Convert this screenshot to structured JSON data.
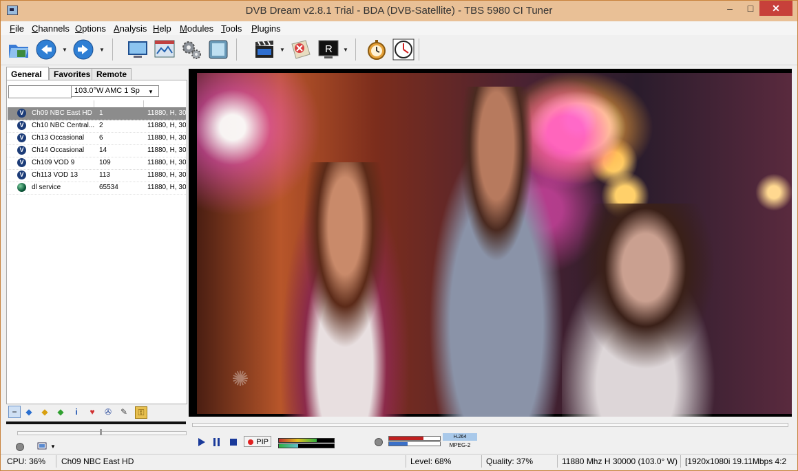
{
  "window": {
    "title": "DVB Dream v2.8.1 Trial - BDA (DVB-Satellite)  -  TBS 5980 CI Tuner",
    "buttons": {
      "minimize": "–",
      "maximize": "□",
      "close": "✕"
    }
  },
  "menu": [
    "File",
    "Channels",
    "Options",
    "Analysis",
    "Help",
    "Modules",
    "Tools",
    "Plugins"
  ],
  "toolbar": {
    "icons": [
      "open-folder-icon",
      "back-icon",
      "forward-icon",
      "monitor-icon",
      "epg-icon",
      "settings-gears-icon",
      "snapshot-icon",
      "clapperboard-icon",
      "stop-record-icon",
      "record-r-icon",
      "timer-stopwatch-icon",
      "clock-icon"
    ]
  },
  "left_panel": {
    "tabs": [
      "General",
      "Favorites",
      "Remote"
    ],
    "active_tab": "General",
    "filter": {
      "value": ""
    },
    "satellite": "103.0°W AMC 1   Sp",
    "channels": [
      {
        "name": "Ch09 NBC East HD",
        "number": "1",
        "freq": "11880, H, 30",
        "icon": "tv-channel-icon",
        "selected": true
      },
      {
        "name": "Ch10 NBC Central...",
        "number": "2",
        "freq": "11880, H, 30",
        "icon": "tv-channel-icon",
        "selected": false
      },
      {
        "name": "Ch13 Occasional",
        "number": "6",
        "freq": "11880, H, 30",
        "icon": "tv-channel-icon",
        "selected": false
      },
      {
        "name": "Ch14 Occasional",
        "number": "14",
        "freq": "11880, H, 30",
        "icon": "tv-channel-icon",
        "selected": false
      },
      {
        "name": "Ch109 VOD 9",
        "number": "109",
        "freq": "11880, H, 30",
        "icon": "tv-channel-icon",
        "selected": false
      },
      {
        "name": "Ch113 VOD 13",
        "number": "113",
        "freq": "11880, H, 30",
        "icon": "tv-channel-icon",
        "selected": false
      },
      {
        "name": "dl service",
        "number": "65534",
        "freq": "11880, H, 30",
        "icon": "data-service-globe-icon",
        "selected": false
      }
    ]
  },
  "playback": {
    "pip_label": "PIP",
    "codec_video": "H.264",
    "codec_audio": "MPEG-2",
    "signal_level_fraction": 0.68,
    "signal_quality_fraction": 0.37
  },
  "status": {
    "cpu": "CPU: 36%",
    "channel": "Ch09 NBC East HD",
    "level": "Level: 68%",
    "quality": "Quality: 37%",
    "tuning": "11880 Mhz  H  30000  (103.0° W)",
    "stream": "[1920x1080i  19.11Mbps 4:2"
  }
}
